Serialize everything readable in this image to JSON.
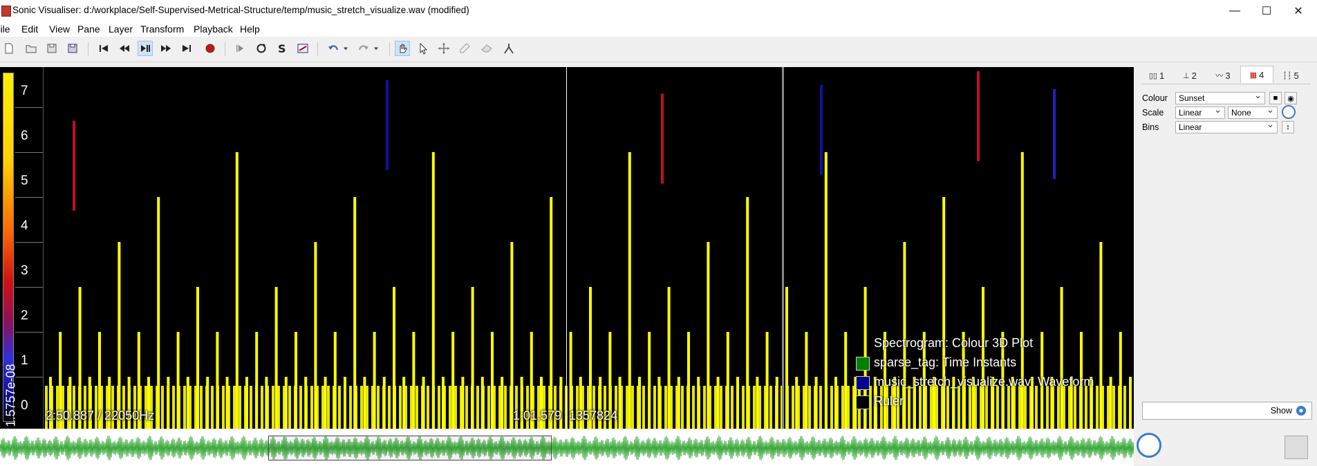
{
  "window": {
    "title": "Sonic Visualiser: d:/workplace/Self-Supervised-Metrical-Structure/temp/music_stretch_visualize.wav (modified)",
    "controls": [
      "—",
      "☐",
      "✕"
    ]
  },
  "menu": [
    "File",
    "Edit",
    "View",
    "Pane",
    "Layer",
    "Transform",
    "Playback",
    "Help"
  ],
  "toolbar": {
    "buttons": [
      "new-file",
      "open",
      "save",
      "save-as",
      "rewind-start",
      "rewind",
      "play-pause",
      "fast-forward",
      "ffwd-end",
      "record",
      "play-selection",
      "loop",
      "solo",
      "speed",
      "undo",
      "undo-menu",
      "redo",
      "redo-menu",
      "navigate",
      "select",
      "move",
      "draw",
      "erase",
      "measure"
    ]
  },
  "scale": {
    "labels": [
      "7",
      "6",
      "5",
      "4",
      "3",
      "2",
      "1",
      "0"
    ],
    "vertical_value": "1.5757e-08"
  },
  "overlay": {
    "left_info": "2:50.887 / 22050Hz",
    "center_info": "1:01.579",
    "frame_info": "1357824"
  },
  "legend": [
    {
      "label": "Spectrogram: Colour 3D Plot",
      "color": ""
    },
    {
      "label": "sparse_tag: Time Instants",
      "color": "#008000"
    },
    {
      "label": "music_stretch_visualize.wav: Waveform",
      "color": "#000090"
    },
    {
      "label": "Ruler",
      "color": "#000000"
    }
  ],
  "side_tabs": [
    "1",
    "2",
    "3",
    "4",
    "5"
  ],
  "properties": {
    "colour_label": "Colour",
    "colour_value": "Sunset",
    "scale_label": "Scale",
    "scale_value": "Linear",
    "scale_norm": "None",
    "bins_label": "Bins",
    "bins_value": "Linear"
  },
  "show_label": "Show",
  "colors": {
    "bar": "#ffff00",
    "waveform": "#3aa83a",
    "waveform_dark": "#107a10"
  }
}
